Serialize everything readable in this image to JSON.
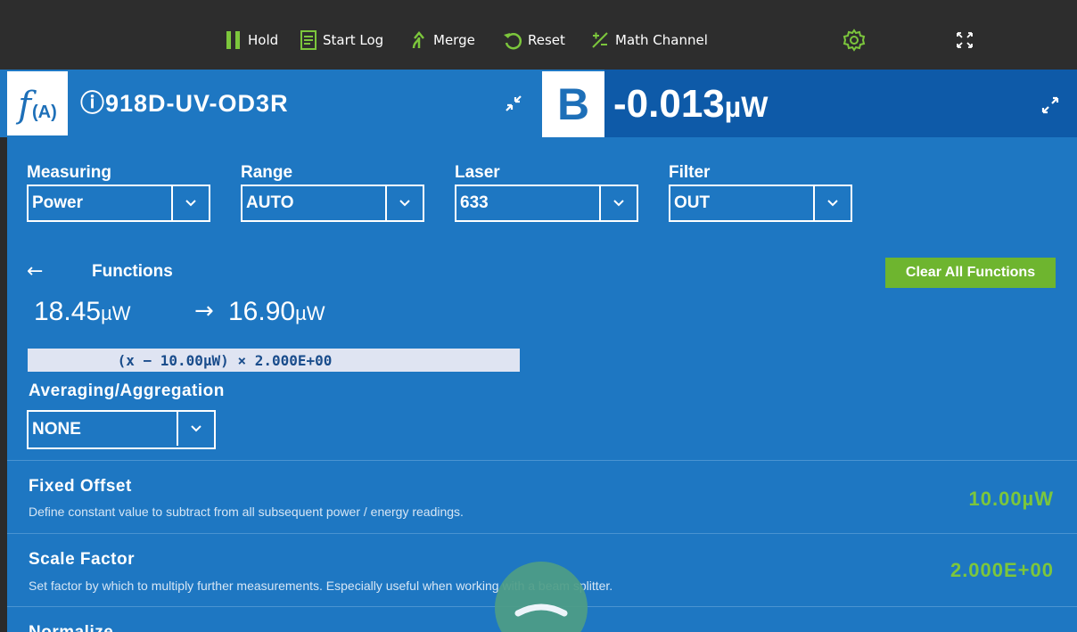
{
  "toolbar": {
    "hold_label": "Hold",
    "start_log_label": "Start Log",
    "merge_label": "Merge",
    "reset_label": "Reset",
    "math_channel_label": "Math Channel",
    "icons": [
      "pause-icon",
      "log-icon",
      "merge-icon",
      "reset-icon",
      "math-icon",
      "settings-icon",
      "fullscreen-icon"
    ],
    "accent_color": "#7cc63c"
  },
  "channel_a": {
    "function_symbol": "f",
    "function_channel": "(A)",
    "device_name": "ⓘ918D-UV-OD3R"
  },
  "channel_b": {
    "label": "B",
    "reading_value": "-0.013",
    "reading_unit": "µW"
  },
  "selectors": {
    "measuring": {
      "label": "Measuring",
      "value": "Power"
    },
    "range": {
      "label": "Range",
      "value": "AUTO"
    },
    "laser": {
      "label": "Laser",
      "value": "633"
    },
    "filter": {
      "label": "Filter",
      "value": "OUT"
    }
  },
  "functions": {
    "title": "Functions",
    "clear_label": "Clear All Functions",
    "input_value": "18.45",
    "input_unit": "µW",
    "output_value": "16.90",
    "output_unit": "µW",
    "formula": "(x − 10.00µW) × 2.000E+00"
  },
  "averaging": {
    "label": "Averaging/Aggregation",
    "value": "NONE"
  },
  "rows": [
    {
      "title": "Fixed Offset",
      "description": "Define constant value to subtract from all subsequent power / energy readings.",
      "value": "10.00µW"
    },
    {
      "title": "Scale Factor",
      "description": "Set factor by which to multiply further measurements. Especially useful when working with a beam splitter.",
      "value": "2.000E+00"
    },
    {
      "title": "Normalize",
      "description": "",
      "value": ""
    }
  ],
  "colors": {
    "panel_blue": "#1e77c2",
    "reading_blue": "#0e5aa8",
    "green": "#6eb52f"
  }
}
